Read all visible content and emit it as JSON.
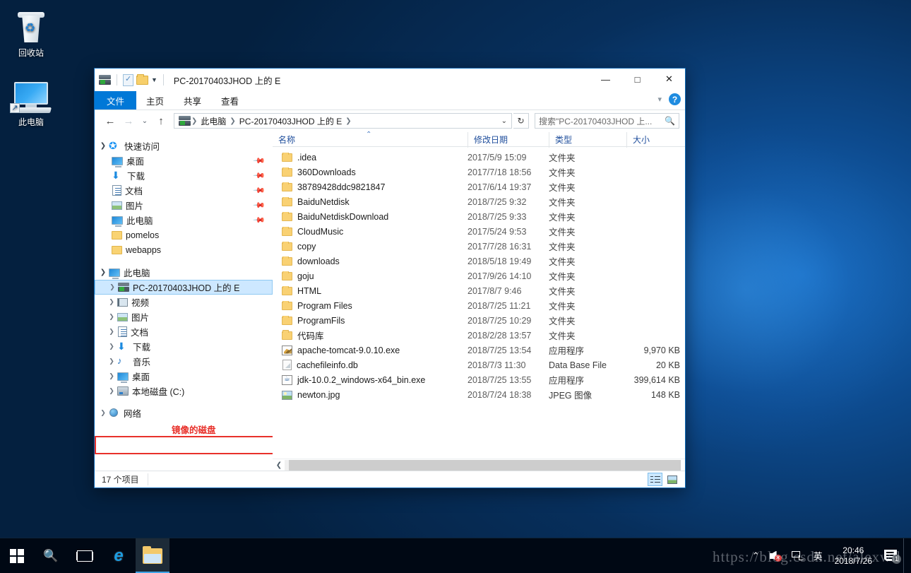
{
  "desktop": {
    "icons": [
      {
        "label": "回收站",
        "icon": "recycle-bin-icon"
      },
      {
        "label": "此电脑",
        "icon": "this-pc-icon"
      }
    ]
  },
  "window": {
    "title": "PC-20170403JHOD 上的 E",
    "quick_access_toolbar": [
      {
        "icon": "network-drive-icon"
      },
      {
        "icon": "properties-icon"
      },
      {
        "icon": "new-folder-icon"
      },
      {
        "icon": "chevron-down-icon"
      }
    ],
    "controls": {
      "minimize": "—",
      "maximize": "❐",
      "close": "✕"
    },
    "ribbon_tabs": [
      {
        "label": "文件",
        "active": true
      },
      {
        "label": "主页",
        "active": false
      },
      {
        "label": "共享",
        "active": false
      },
      {
        "label": "查看",
        "active": false
      }
    ],
    "ribbon_expand_icon": "chevron-down-icon",
    "help_label": "?"
  },
  "navigation": {
    "back_icon": "←",
    "forward_icon": "→",
    "recent_icon": "⌄",
    "up_icon": "↑",
    "breadcrumb": [
      "此电脑",
      "PC-20170403JHOD 上的 E"
    ],
    "address_caret": "⌄",
    "refresh_icon": "↻",
    "search_placeholder": "搜索\"PC-20170403JHOD 上...",
    "search_icon": "search-icon"
  },
  "sidebar": {
    "quick_access": {
      "label": "快速访问",
      "items": [
        {
          "label": "桌面",
          "icon": "monitor-icon",
          "pinned": true
        },
        {
          "label": "下载",
          "icon": "download-icon",
          "pinned": true
        },
        {
          "label": "文档",
          "icon": "document-icon",
          "pinned": true
        },
        {
          "label": "图片",
          "icon": "picture-icon",
          "pinned": true
        },
        {
          "label": "此电脑",
          "icon": "this-pc-icon",
          "pinned": true
        },
        {
          "label": "pomelos",
          "icon": "folder-icon",
          "pinned": false
        },
        {
          "label": "webapps",
          "icon": "folder-icon",
          "pinned": false
        }
      ]
    },
    "this_pc": {
      "label": "此电脑",
      "items": [
        {
          "label": "PC-20170403JHOD 上的 E",
          "icon": "network-drive-icon",
          "selected": true
        },
        {
          "label": "视频",
          "icon": "video-icon",
          "selected": false
        },
        {
          "label": "图片",
          "icon": "picture-icon",
          "selected": false
        },
        {
          "label": "文档",
          "icon": "document-icon",
          "selected": false
        },
        {
          "label": "下载",
          "icon": "download-icon",
          "selected": false
        },
        {
          "label": "音乐",
          "icon": "music-icon",
          "selected": false
        },
        {
          "label": "桌面",
          "icon": "monitor-icon",
          "selected": false
        },
        {
          "label": "本地磁盘 (C:)",
          "icon": "hard-drive-icon",
          "selected": false
        }
      ]
    },
    "network": {
      "label": "网络",
      "icon": "network-icon"
    },
    "annotation": {
      "text": "镜像的磁盘",
      "color": "#e8312b"
    }
  },
  "filelist": {
    "columns": [
      "名称",
      "修改日期",
      "类型",
      "大小"
    ],
    "sort_column": "名称",
    "sort_caret": "⌃",
    "rows": [
      {
        "name": ".idea",
        "date": "2017/5/9 15:09",
        "type": "文件夹",
        "size": "",
        "icon": "folder-icon"
      },
      {
        "name": "360Downloads",
        "date": "2017/7/18 18:56",
        "type": "文件夹",
        "size": "",
        "icon": "folder-icon"
      },
      {
        "name": "38789428ddc9821847",
        "date": "2017/6/14 19:37",
        "type": "文件夹",
        "size": "",
        "icon": "folder-icon"
      },
      {
        "name": "BaiduNetdisk",
        "date": "2018/7/25 9:32",
        "type": "文件夹",
        "size": "",
        "icon": "folder-icon"
      },
      {
        "name": "BaiduNetdiskDownload",
        "date": "2018/7/25 9:33",
        "type": "文件夹",
        "size": "",
        "icon": "folder-icon"
      },
      {
        "name": "CloudMusic",
        "date": "2017/5/24 9:53",
        "type": "文件夹",
        "size": "",
        "icon": "folder-icon"
      },
      {
        "name": "copy",
        "date": "2017/7/28 16:31",
        "type": "文件夹",
        "size": "",
        "icon": "folder-icon"
      },
      {
        "name": "downloads",
        "date": "2018/5/18 19:49",
        "type": "文件夹",
        "size": "",
        "icon": "folder-icon"
      },
      {
        "name": "goju",
        "date": "2017/9/26 14:10",
        "type": "文件夹",
        "size": "",
        "icon": "folder-icon"
      },
      {
        "name": "HTML",
        "date": "2017/8/7 9:46",
        "type": "文件夹",
        "size": "",
        "icon": "folder-icon"
      },
      {
        "name": "Program Files",
        "date": "2018/7/25 11:21",
        "type": "文件夹",
        "size": "",
        "icon": "folder-icon"
      },
      {
        "name": "ProgramFils",
        "date": "2018/7/25 10:29",
        "type": "文件夹",
        "size": "",
        "icon": "folder-icon"
      },
      {
        "name": "代码库",
        "date": "2018/2/28 13:57",
        "type": "文件夹",
        "size": "",
        "icon": "folder-icon"
      },
      {
        "name": "apache-tomcat-9.0.10.exe",
        "date": "2018/7/25 13:54",
        "type": "应用程序",
        "size": "9,970 KB",
        "icon": "tomcat-exe-icon"
      },
      {
        "name": "cachefileinfo.db",
        "date": "2018/7/3 11:30",
        "type": "Data Base File",
        "size": "20 KB",
        "icon": "database-file-icon"
      },
      {
        "name": "jdk-10.0.2_windows-x64_bin.exe",
        "date": "2018/7/25 13:55",
        "type": "应用程序",
        "size": "399,614 KB",
        "icon": "java-exe-icon"
      },
      {
        "name": "newton.jpg",
        "date": "2018/7/24 18:38",
        "type": "JPEG 图像",
        "size": "148 KB",
        "icon": "jpeg-image-icon"
      }
    ]
  },
  "statusbar": {
    "item_count": "17 个项目",
    "view_details_icon": "details-view-icon",
    "view_icons_icon": "large-icons-view-icon"
  },
  "taskbar": {
    "buttons": [
      {
        "name": "start-button",
        "icon": "windows-logo-icon"
      },
      {
        "name": "search-button",
        "icon": "search-icon"
      },
      {
        "name": "task-view-button",
        "icon": "task-view-icon"
      },
      {
        "name": "internet-explorer-button",
        "icon": "internet-explorer-icon"
      },
      {
        "name": "file-explorer-button",
        "icon": "file-explorer-icon",
        "active": true
      }
    ],
    "tray": {
      "chevron": "⌃",
      "volume_icon": "volume-muted-icon",
      "network_icon": "network-icon",
      "ime_label": "英",
      "time": "20:46",
      "date": "2018/7/26",
      "notification_icon": "notification-icon",
      "notification_count": "1"
    }
  },
  "watermark": {
    "text": "https://blog.csdn.net/alexwll"
  }
}
